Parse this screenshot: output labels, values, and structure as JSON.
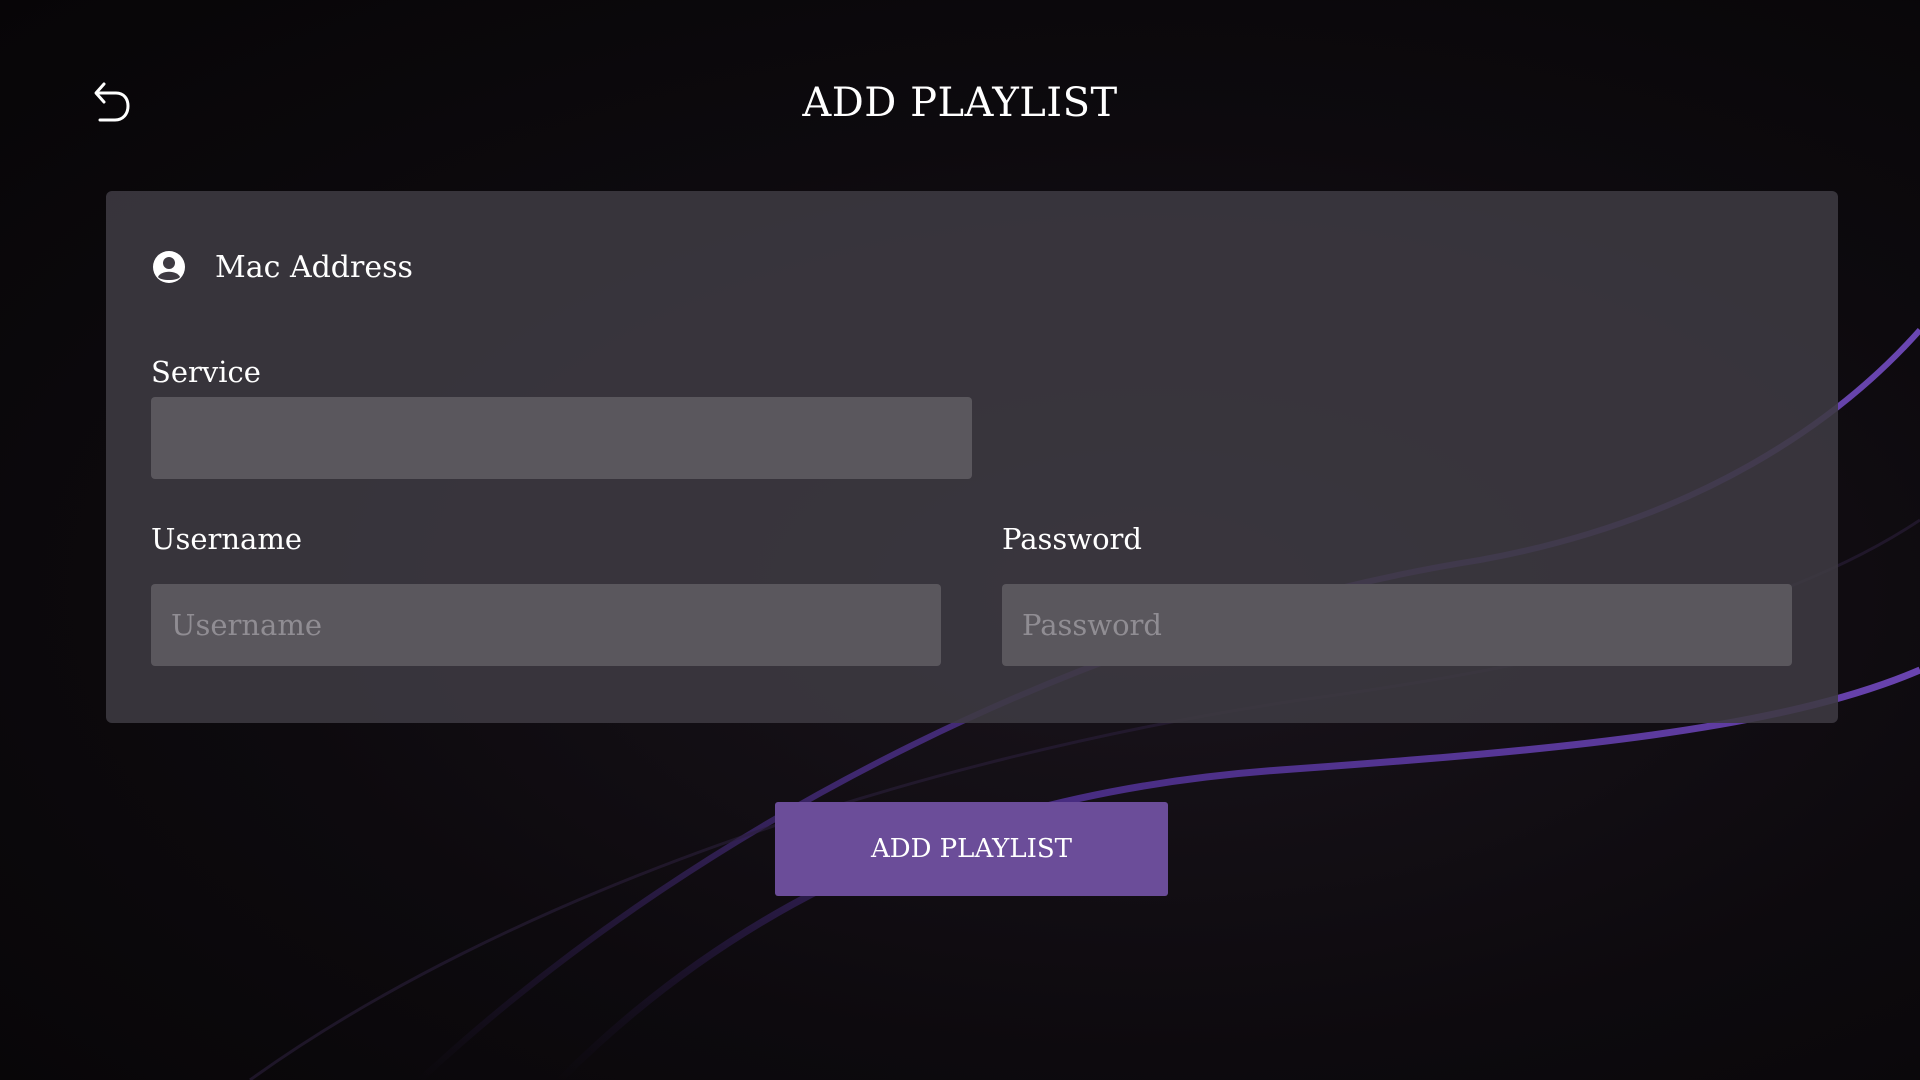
{
  "header": {
    "title": "ADD PLAYLIST",
    "back_icon": "back-arrow-icon"
  },
  "form": {
    "mac_icon": "account-circle-icon",
    "mac_label": "Mac Address",
    "service": {
      "label": "Service",
      "value": "",
      "placeholder": ""
    },
    "username": {
      "label": "Username",
      "value": "",
      "placeholder": "Username"
    },
    "password": {
      "label": "Password",
      "value": "",
      "placeholder": "Password"
    },
    "submit_label": "ADD PLAYLIST"
  },
  "colors": {
    "background": "#0b080c",
    "card": "#3e3a42",
    "input": "#5a575d",
    "accent": "#6b4d99",
    "wave": "#5b3a99"
  }
}
